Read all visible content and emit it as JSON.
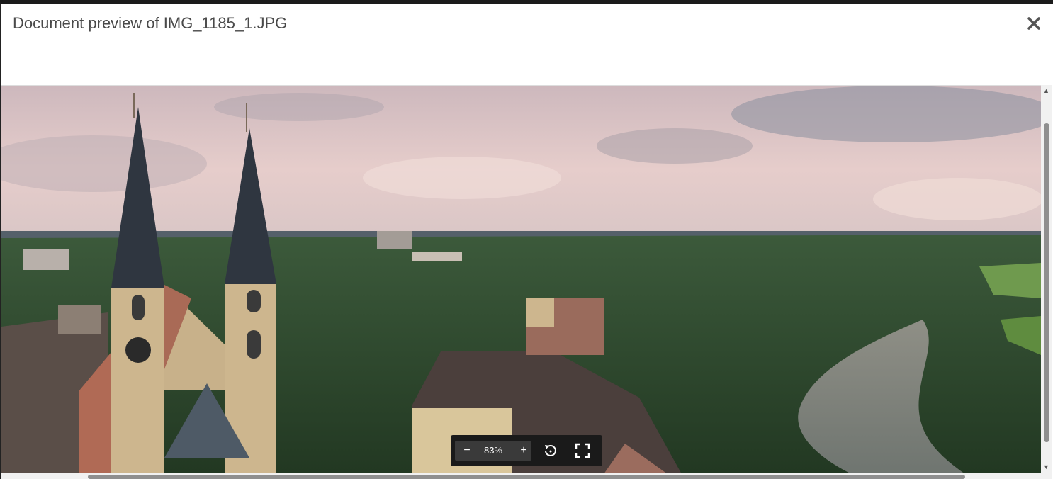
{
  "dialog": {
    "title": "Document preview of IMG_1185_1.JPG",
    "close_icon": "close-icon"
  },
  "viewer": {
    "image_file": "IMG_1185_1.JPG",
    "image_description_icon": "landscape-photo"
  },
  "toolbar": {
    "zoom_out_label": "−",
    "zoom_level": "83%",
    "zoom_in_label": "+",
    "rotate_icon": "rotate-icon",
    "fullscreen_icon": "fullscreen-icon"
  },
  "colors": {
    "toolbar_bg": "#1a1a1a",
    "zoom_group_bg": "#3a3a3a",
    "title_text": "#4a4a4a"
  }
}
